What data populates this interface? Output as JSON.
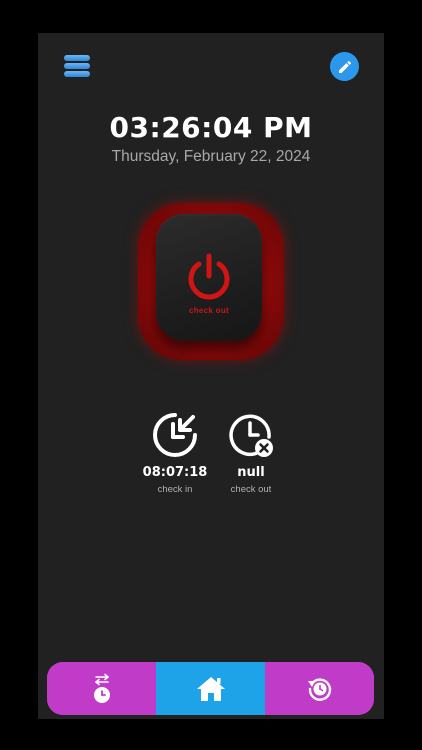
{
  "header": {
    "menu_icon": "hamburger-menu-icon",
    "edit_icon": "pencil-icon"
  },
  "clock": {
    "time": "03:26:04 PM",
    "date": "Thursday, February 22, 2024"
  },
  "power_button": {
    "icon": "power-icon",
    "label": "check out"
  },
  "stats": [
    {
      "icon": "check-in-clock-icon",
      "value": "08:07:18",
      "label": "check in"
    },
    {
      "icon": "check-out-clock-icon",
      "value": "null",
      "label": "check out"
    }
  ],
  "bottom_nav": {
    "items": [
      {
        "icon": "swap-clock-icon",
        "active": false
      },
      {
        "icon": "home-icon",
        "active": true
      },
      {
        "icon": "history-icon",
        "active": false
      }
    ]
  },
  "colors": {
    "background": "#212121",
    "accent_blue": "#1ea2e8",
    "nav_purple": "#c03cc8",
    "power_red": "#b01010"
  }
}
